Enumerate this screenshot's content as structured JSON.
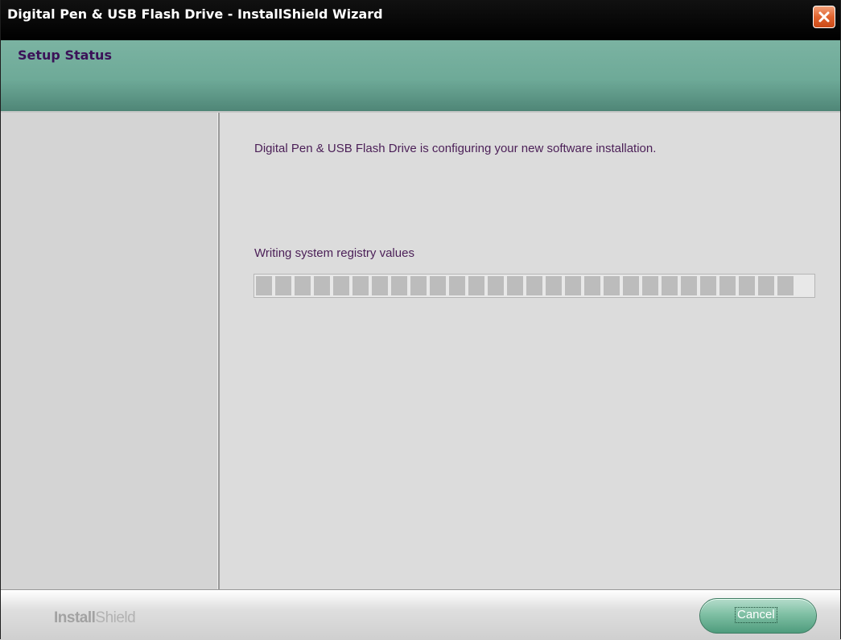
{
  "window": {
    "title": "Digital Pen & USB Flash Drive - InstallShield Wizard"
  },
  "header": {
    "title": "Setup Status"
  },
  "main": {
    "message": "Digital Pen & USB Flash Drive is configuring your new software installation.",
    "status": "Writing system registry values",
    "progress_fraction": 0.95
  },
  "footer": {
    "brand_bold": "Install",
    "brand_light": "Shield",
    "cancel_label": "Cancel"
  },
  "icons": {
    "close": "close-icon"
  },
  "colors": {
    "header_bg": "#6eaa98",
    "text_purple": "#4b1f57",
    "close_red": "#e0642f",
    "button_green": "#7fc0a4"
  }
}
